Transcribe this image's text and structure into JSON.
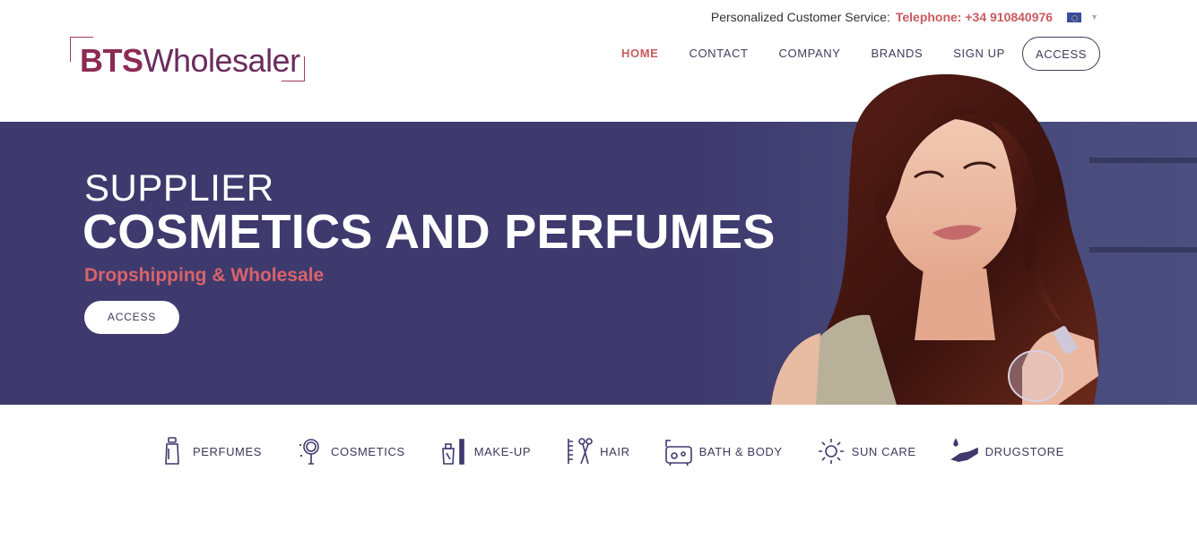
{
  "topbar": {
    "service_label": "Personalized Customer Service:",
    "phone": "Telephone: +34 910840976",
    "flag_icon": "eu-flag-icon"
  },
  "logo": {
    "part1": "BTS",
    "part2": "Wholesaler"
  },
  "nav": {
    "items": [
      {
        "label": "HOME",
        "active": true
      },
      {
        "label": "CONTACT"
      },
      {
        "label": "COMPANY"
      },
      {
        "label": "BRANDS"
      },
      {
        "label": "SIGN UP"
      },
      {
        "label": "ACCESS"
      }
    ]
  },
  "hero": {
    "kicker": "SUPPLIER",
    "title": "COSMETICS AND PERFUMES",
    "subtitle": "Dropshipping & Wholesale",
    "button": "ACCESS",
    "background_color": "#3e3a6e",
    "accent_color": "#d9636a"
  },
  "categories": [
    {
      "label": "PERFUMES",
      "icon": "perfume-bottle-icon"
    },
    {
      "label": "COSMETICS",
      "icon": "mirror-icon"
    },
    {
      "label": "MAKE-UP",
      "icon": "nail-polish-icon"
    },
    {
      "label": "HAIR",
      "icon": "comb-scissors-icon"
    },
    {
      "label": "BATH & BODY",
      "icon": "bathtub-icon"
    },
    {
      "label": "SUN CARE",
      "icon": "sun-icon"
    },
    {
      "label": "DRUGSTORE",
      "icon": "hand-drop-icon"
    }
  ]
}
